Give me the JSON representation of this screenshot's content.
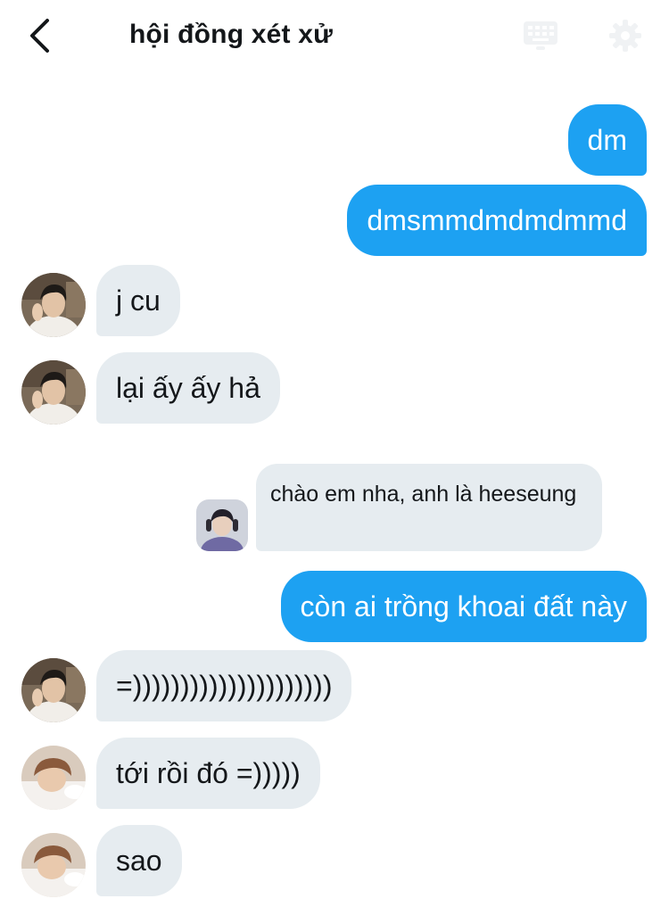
{
  "header": {
    "title": "hội đồng xét xử",
    "back_icon": "chevron-left-icon",
    "keyboard_icon": "keyboard-icon",
    "settings_icon": "gear-icon"
  },
  "colors": {
    "outgoing_bubble": "#1da1f2",
    "incoming_bubble": "#e6ecf0",
    "text": "#14171a"
  },
  "messages": [
    {
      "direction": "outgoing",
      "text": "dm"
    },
    {
      "direction": "outgoing",
      "text": "dmsmmdmdmdmmd"
    },
    {
      "direction": "incoming",
      "sender": "avatar-1",
      "text": "j cu"
    },
    {
      "direction": "incoming",
      "sender": "avatar-1",
      "text": "lại ấy ấy hả"
    },
    {
      "direction": "quoted",
      "sender": "avatar-2",
      "text": "chào em nha, anh là heeseung"
    },
    {
      "direction": "outgoing",
      "text": "còn ai trồng khoai đất này"
    },
    {
      "direction": "incoming",
      "sender": "avatar-1",
      "text": "=)))))))))))))))))))))"
    },
    {
      "direction": "incoming",
      "sender": "avatar-3",
      "text": "tới rồi đó =)))))"
    },
    {
      "direction": "incoming",
      "sender": "avatar-3",
      "text": "sao"
    }
  ]
}
